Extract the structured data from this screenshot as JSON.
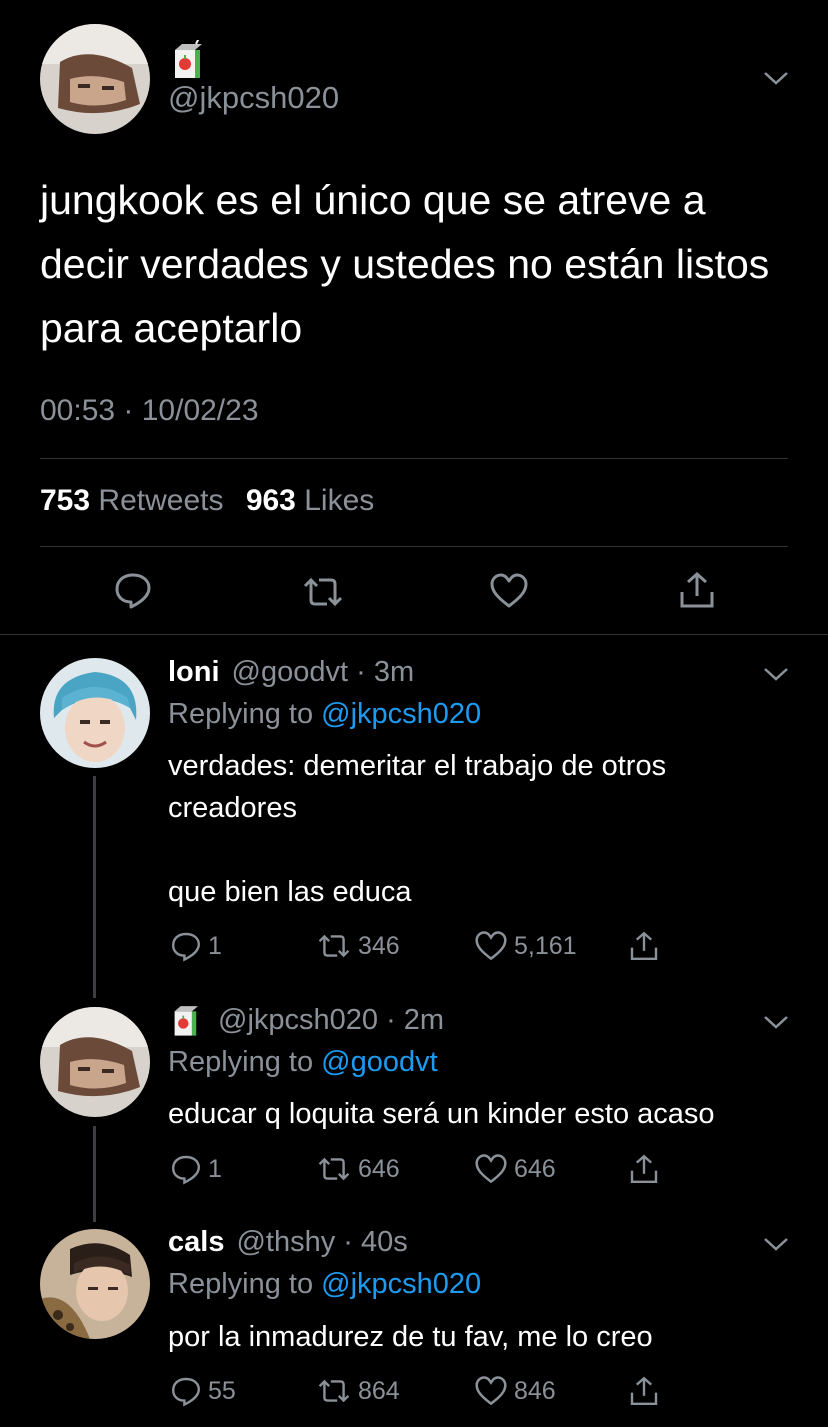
{
  "main_tweet": {
    "handle": "@jkpcsh020",
    "text": "jungkook es el único que se atreve a decir verdades y ustedes no están listos para aceptarlo",
    "timestamp": "00:53 · 10/02/23",
    "retweets_count": "753",
    "retweets_label": "Retweets",
    "likes_count": "963",
    "likes_label": "Likes",
    "badge_icon": "juice-box-icon"
  },
  "replies": [
    {
      "name": "loni",
      "handle": "@goodvt · 3m",
      "replying_prefix": "Replying to ",
      "replying_to": "@jkpcsh020",
      "text_line1": "verdades: demeritar el trabajo de otros",
      "text_line2": "creadores",
      "text_line3": "que bien las educa",
      "replies": "1",
      "retweets": "346",
      "likes": "5,161"
    },
    {
      "name": "",
      "handle": "@jkpcsh020 · 2m",
      "replying_prefix": "Replying to ",
      "replying_to": "@goodvt",
      "text_line1": "educar q loquita será un kinder esto acaso",
      "replies": "1",
      "retweets": "646",
      "likes": "646"
    },
    {
      "name": "cals",
      "handle": "@thshy · 40s",
      "replying_prefix": "Replying to ",
      "replying_to": "@jkpcsh020",
      "text_line1": "por la inmadurez de tu fav, me lo creo",
      "replies": "55",
      "retweets": "864",
      "likes": "846"
    }
  ],
  "colors": {
    "background": "#000000",
    "muted": "#8b9199",
    "link": "#1d9bf0",
    "divider": "#2f3336"
  }
}
